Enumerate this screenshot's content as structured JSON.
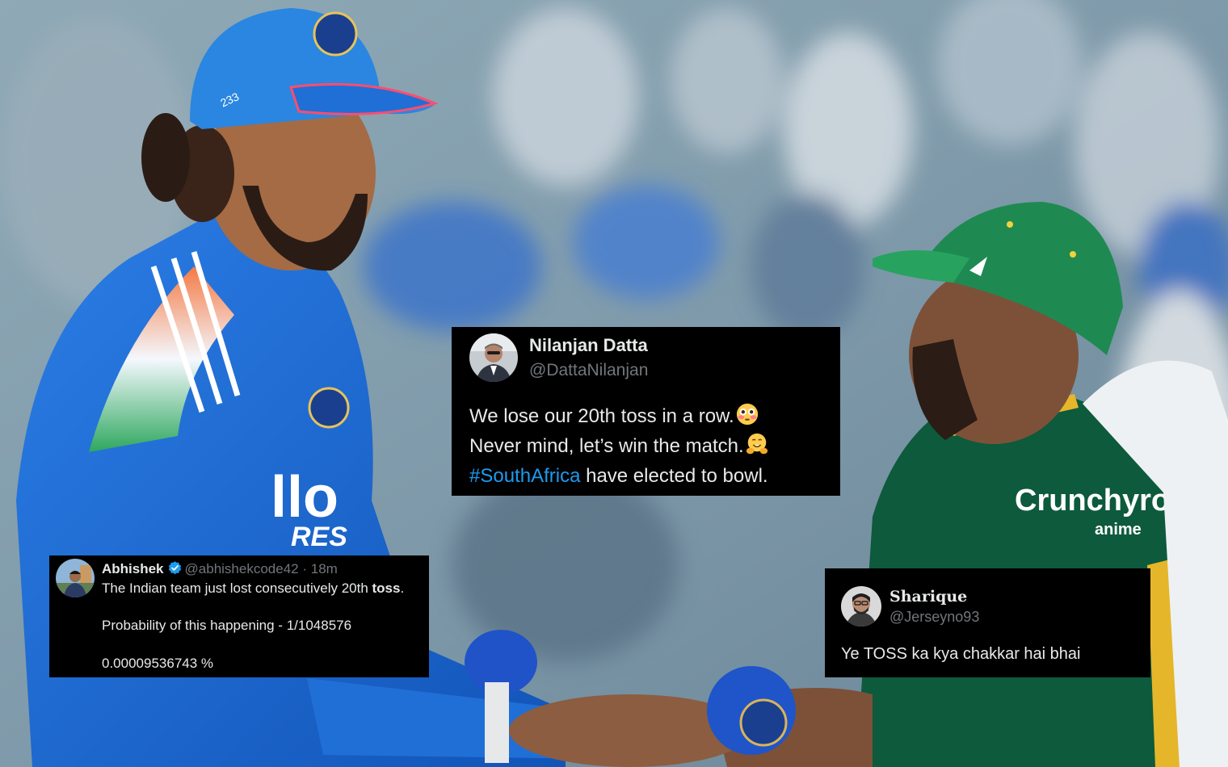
{
  "colors": {
    "tweet_background": "#000000",
    "primary_text": "#e7e9ea",
    "secondary_text": "#71767b",
    "hashtag": "#1d9bf0",
    "verified_badge": "#1d9bf0",
    "india_kit_blue": "#1f6fd6",
    "south_africa_green": "#0d5a3c",
    "south_africa_gold": "#e5b62a"
  },
  "background_photo": {
    "left_cap_number": "233",
    "sponsor_left": "llo",
    "sponsor_left_sub": "RES",
    "sponsor_right": "Crunchyro",
    "sponsor_right_sub": "anime"
  },
  "tweets": [
    {
      "name": "Nilanjan Datta",
      "handle": "@DattaNilanjan",
      "lines": [
        {
          "text": "We lose our 20th toss in a row.",
          "emoji": "flushed-face-icon"
        },
        {
          "text": "Never mind, let’s win the match.",
          "emoji": "hugging-face-icon"
        },
        {
          "hashtag": "#SouthAfrica",
          "text": " have elected to bowl."
        }
      ]
    },
    {
      "name": "Abhishek",
      "verified": true,
      "handle": "@abhishekcode42",
      "separator": " · ",
      "time": "18m",
      "line1_prefix": "The Indian team just lost consecutively 20th ",
      "line1_bold": "toss",
      "line1_suffix": ".",
      "line2": "Probability of this happening - 1/1048576",
      "line3": "0.00009536743 %"
    },
    {
      "name": "Sharique",
      "handle": "@Jerseyno93",
      "text": "Ye TOSS ka kya chakkar hai bhai"
    }
  ]
}
